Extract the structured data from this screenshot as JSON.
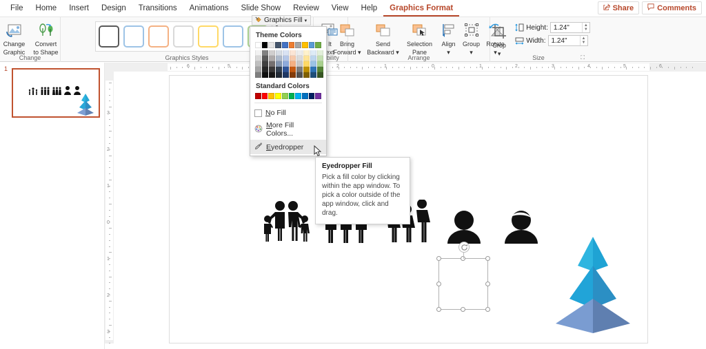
{
  "app": {
    "ribbon_collapse_icon": "chevron-up-icon"
  },
  "menubar": {
    "tabs": [
      {
        "label": "File",
        "active": false
      },
      {
        "label": "Home",
        "active": false
      },
      {
        "label": "Insert",
        "active": false
      },
      {
        "label": "Design",
        "active": false
      },
      {
        "label": "Transitions",
        "active": false
      },
      {
        "label": "Animations",
        "active": false
      },
      {
        "label": "Slide Show",
        "active": false
      },
      {
        "label": "Review",
        "active": false
      },
      {
        "label": "View",
        "active": false
      },
      {
        "label": "Help",
        "active": false
      },
      {
        "label": "Graphics Format",
        "active": true
      }
    ],
    "share_label": "Share",
    "share_icon": "share-icon",
    "comments_label": "Comments",
    "comments_icon": "comment-icon",
    "accent_color": "#b7472a"
  },
  "ribbon": {
    "groups": [
      {
        "name": "Change",
        "label": "Change"
      },
      {
        "name": "Graphics Styles",
        "label": "Graphics Styles"
      },
      {
        "name": "Accessibility",
        "label": "sibility"
      },
      {
        "name": "Arrange",
        "label": "Arrange"
      },
      {
        "name": "Size",
        "label": "Size"
      }
    ],
    "change": {
      "change_graphic_line1": "Change",
      "change_graphic_line2": "Graphic",
      "change_graphic_icon": "change-graphic-icon",
      "convert_line1": "Convert",
      "convert_line2": "to Shape",
      "convert_icon": "convert-to-shape-icon"
    },
    "styles": {
      "fill_button_label": "Graphics Fill",
      "fill_button_icon": "graphics-fill-icon",
      "scroll_up_icon": "caret-up-icon",
      "scroll_down_icon": "caret-down-icon",
      "more_icon": "more-styles-icon",
      "chips": [
        {
          "border": "#595959"
        },
        {
          "border": "#9dc3e6"
        },
        {
          "border": "#f4b183"
        },
        {
          "border": "#d9d9d9"
        },
        {
          "border": "#ffd966"
        },
        {
          "border": "#9dc3e6"
        },
        {
          "border": "#a9d18e"
        }
      ]
    },
    "accessibility": {
      "alt_text_line1": "lt",
      "alt_text_line2": "ext",
      "alt_text_icon": "alt-text-icon"
    },
    "arrange": {
      "bring_forward_line1": "Bring",
      "bring_forward_line2": "Forward",
      "bring_forward_icon": "bring-forward-icon",
      "send_backward_line1": "Send",
      "send_backward_line2": "Backward",
      "send_backward_icon": "send-backward-icon",
      "selection_pane_line1": "Selection",
      "selection_pane_line2": "Pane",
      "selection_pane_icon": "selection-pane-icon",
      "align_label": "Align",
      "align_icon": "align-icon",
      "group_label": "Group",
      "group_icon": "group-icon",
      "rotate_label": "Rotate",
      "rotate_icon": "rotate-icon"
    },
    "size": {
      "crop_label": "Crop",
      "crop_icon": "crop-icon",
      "height_label": "Height:",
      "height_value": "1.24\"",
      "height_icon": "height-icon",
      "width_label": "Width:",
      "width_value": "1.24\"",
      "width_icon": "width-icon",
      "dialog_launcher_icon": "dialog-launcher-icon"
    }
  },
  "fill_dropdown": {
    "theme_colors_title": "Theme Colors",
    "theme_colors": [
      {
        "base": "#ffffff",
        "variants": [
          "#f2f2f2",
          "#d8d8d8",
          "#bfbfbf",
          "#a5a5a5",
          "#7f7f7f"
        ]
      },
      {
        "base": "#000000",
        "variants": [
          "#808080",
          "#595959",
          "#404040",
          "#262626",
          "#0d0d0d"
        ]
      },
      {
        "base": "#e7e6e6",
        "variants": [
          "#d0cece",
          "#aeaaaa",
          "#757070",
          "#3a3838",
          "#171616"
        ]
      },
      {
        "base": "#44546a",
        "variants": [
          "#d6dce4",
          "#adb9ca",
          "#8496b0",
          "#333f4f",
          "#222a35"
        ]
      },
      {
        "base": "#4472c4",
        "variants": [
          "#d9e2f3",
          "#b4c6e7",
          "#8eaadb",
          "#2f5496",
          "#1f3864"
        ]
      },
      {
        "base": "#ed7d31",
        "variants": [
          "#fbe5d5",
          "#f7caac",
          "#f4b083",
          "#c55a11",
          "#833c0b"
        ]
      },
      {
        "base": "#a5a5a5",
        "variants": [
          "#ededed",
          "#dbdbdb",
          "#c9c9c9",
          "#7b7b7b",
          "#525252"
        ]
      },
      {
        "base": "#ffc000",
        "variants": [
          "#fff2cc",
          "#ffe599",
          "#ffd965",
          "#bf9000",
          "#7f6000"
        ]
      },
      {
        "base": "#5b9bd5",
        "variants": [
          "#deebf6",
          "#bdd6ee",
          "#9cc3e5",
          "#2e74b5",
          "#1f4e79"
        ]
      },
      {
        "base": "#70ad47",
        "variants": [
          "#e2efd9",
          "#c5e0b3",
          "#a8d08d",
          "#538135",
          "#375623"
        ]
      }
    ],
    "standard_colors_title": "Standard Colors",
    "standard_colors": [
      "#c00000",
      "#ff0000",
      "#ffc000",
      "#ffff00",
      "#92d050",
      "#00b050",
      "#00b0f0",
      "#0070c0",
      "#002060",
      "#7030a0"
    ],
    "no_fill_label": "No Fill",
    "no_fill_icon": "no-fill-icon",
    "more_fill_colors_label": "More Fill Colors...",
    "more_fill_colors_icon": "color-wheel-icon",
    "eyedropper_label": "Eyedropper",
    "eyedropper_icon": "eyedropper-icon",
    "eyedropper_highlighted": true
  },
  "tooltip": {
    "title": "Eyedropper Fill",
    "body": "Pick a fill color by clicking within the app window. To pick a color outside of the app window, click and drag."
  },
  "workspace": {
    "slide_number": "1",
    "thumbnail_name": "slide-thumbnail-1",
    "ruler_h_left_labels": [
      "6",
      "5"
    ],
    "ruler_h_right_labels": [
      "2",
      "1",
      "0",
      "1",
      "2",
      "3",
      "4",
      "5",
      "6"
    ],
    "ruler_v_labels": [
      "3",
      "2",
      "1",
      "0",
      "1",
      "2",
      "3"
    ],
    "selected_shape": "family-icon",
    "rotate_handle_icon": "rotate-handle-icon",
    "cursor_icon": "mouse-pointer-icon",
    "icons": [
      {
        "name": "family-icon",
        "selected": true
      },
      {
        "name": "group-of-people-icon",
        "selected": false
      },
      {
        "name": "women-group-icon",
        "selected": false
      },
      {
        "name": "person-icon",
        "selected": false
      },
      {
        "name": "person-with-hat-icon",
        "selected": false
      }
    ],
    "pyramid": {
      "name": "pyramid-graphic",
      "top_light": "#2eb5e0",
      "top_dark": "#1a9fd0",
      "mid_light": "#21a4d8",
      "mid_dark": "#2b8fc4",
      "base_light": "#7a9cd1",
      "base_dark": "#5f7fb0"
    }
  }
}
